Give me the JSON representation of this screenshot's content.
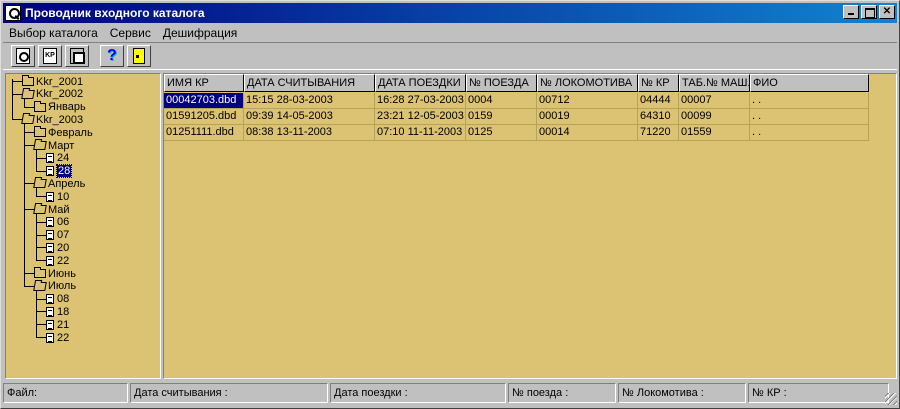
{
  "window": {
    "title": "Проводник входного каталога"
  },
  "menu": [
    "Выбор каталога",
    "Сервис",
    "Дешифрация"
  ],
  "toolbar": [
    {
      "name": "search-button",
      "icon": "magnifier-icon"
    },
    {
      "name": "kr-button",
      "icon": "kr-icon",
      "label": "KP"
    },
    {
      "name": "tape-button",
      "icon": "tape-icon"
    },
    {
      "name": "help-button",
      "icon": "help-icon",
      "label": "?"
    },
    {
      "name": "exit-button",
      "icon": "exit-door-icon"
    }
  ],
  "tree": [
    {
      "label": "Kkr_2001",
      "type": "folder",
      "depth": 0
    },
    {
      "label": "Kkr_2002",
      "type": "folder-open",
      "depth": 0
    },
    {
      "label": "Январь",
      "type": "folder",
      "depth": 1
    },
    {
      "label": "Kkr_2003",
      "type": "folder-open",
      "depth": 0
    },
    {
      "label": "Февраль",
      "type": "folder",
      "depth": 1
    },
    {
      "label": "Март",
      "type": "folder-open",
      "depth": 1
    },
    {
      "label": "24",
      "type": "file",
      "depth": 2
    },
    {
      "label": "28",
      "type": "file",
      "depth": 2,
      "selected": true
    },
    {
      "label": "Апрель",
      "type": "folder-open",
      "depth": 1
    },
    {
      "label": "10",
      "type": "file",
      "depth": 2
    },
    {
      "label": "Май",
      "type": "folder-open",
      "depth": 1
    },
    {
      "label": "06",
      "type": "file",
      "depth": 2
    },
    {
      "label": "07",
      "type": "file",
      "depth": 2
    },
    {
      "label": "20",
      "type": "file",
      "depth": 2
    },
    {
      "label": "22",
      "type": "file",
      "depth": 2
    },
    {
      "label": "Июнь",
      "type": "folder",
      "depth": 1
    },
    {
      "label": "Июль",
      "type": "folder-open",
      "depth": 1
    },
    {
      "label": "08",
      "type": "file",
      "depth": 2
    },
    {
      "label": "18",
      "type": "file",
      "depth": 2
    },
    {
      "label": "21",
      "type": "file",
      "depth": 2
    },
    {
      "label": "22",
      "type": "file",
      "depth": 2
    }
  ],
  "table": {
    "columns": [
      "ИМЯ КР",
      "ДАТА СЧИТЫВАНИЯ",
      "ДАТА ПОЕЗДКИ",
      "№ ПОЕЗДА",
      "№ ЛОКОМОТИВА",
      "№ КР",
      "ТАБ.№ МАШ.",
      "ФИО"
    ],
    "rows": [
      [
        "00042703.dbd",
        "15:15 28-03-2003",
        "16:28 27-03-2003",
        "0004",
        "00712",
        "04444",
        "00007",
        ". ."
      ],
      [
        "01591205.dbd",
        "09:39 14-05-2003",
        "23:21 12-05-2003",
        "0159",
        "00019",
        "64310",
        "00099",
        ". ."
      ],
      [
        "01251111.dbd",
        "08:38 13-11-2003",
        "07:10 11-11-2003",
        "0125",
        "00014",
        "71220",
        "01559",
        ". ."
      ]
    ],
    "selected_row": 0
  },
  "status": [
    "Файл:",
    "Дата считывания :",
    "Дата поездки :",
    "№ поезда :",
    "№ Локомотива :",
    "№ КР :"
  ],
  "colors": {
    "panel_bg": "#dcc373",
    "title_start": "#000080",
    "title_end": "#1084d0",
    "selection": "#000080"
  }
}
